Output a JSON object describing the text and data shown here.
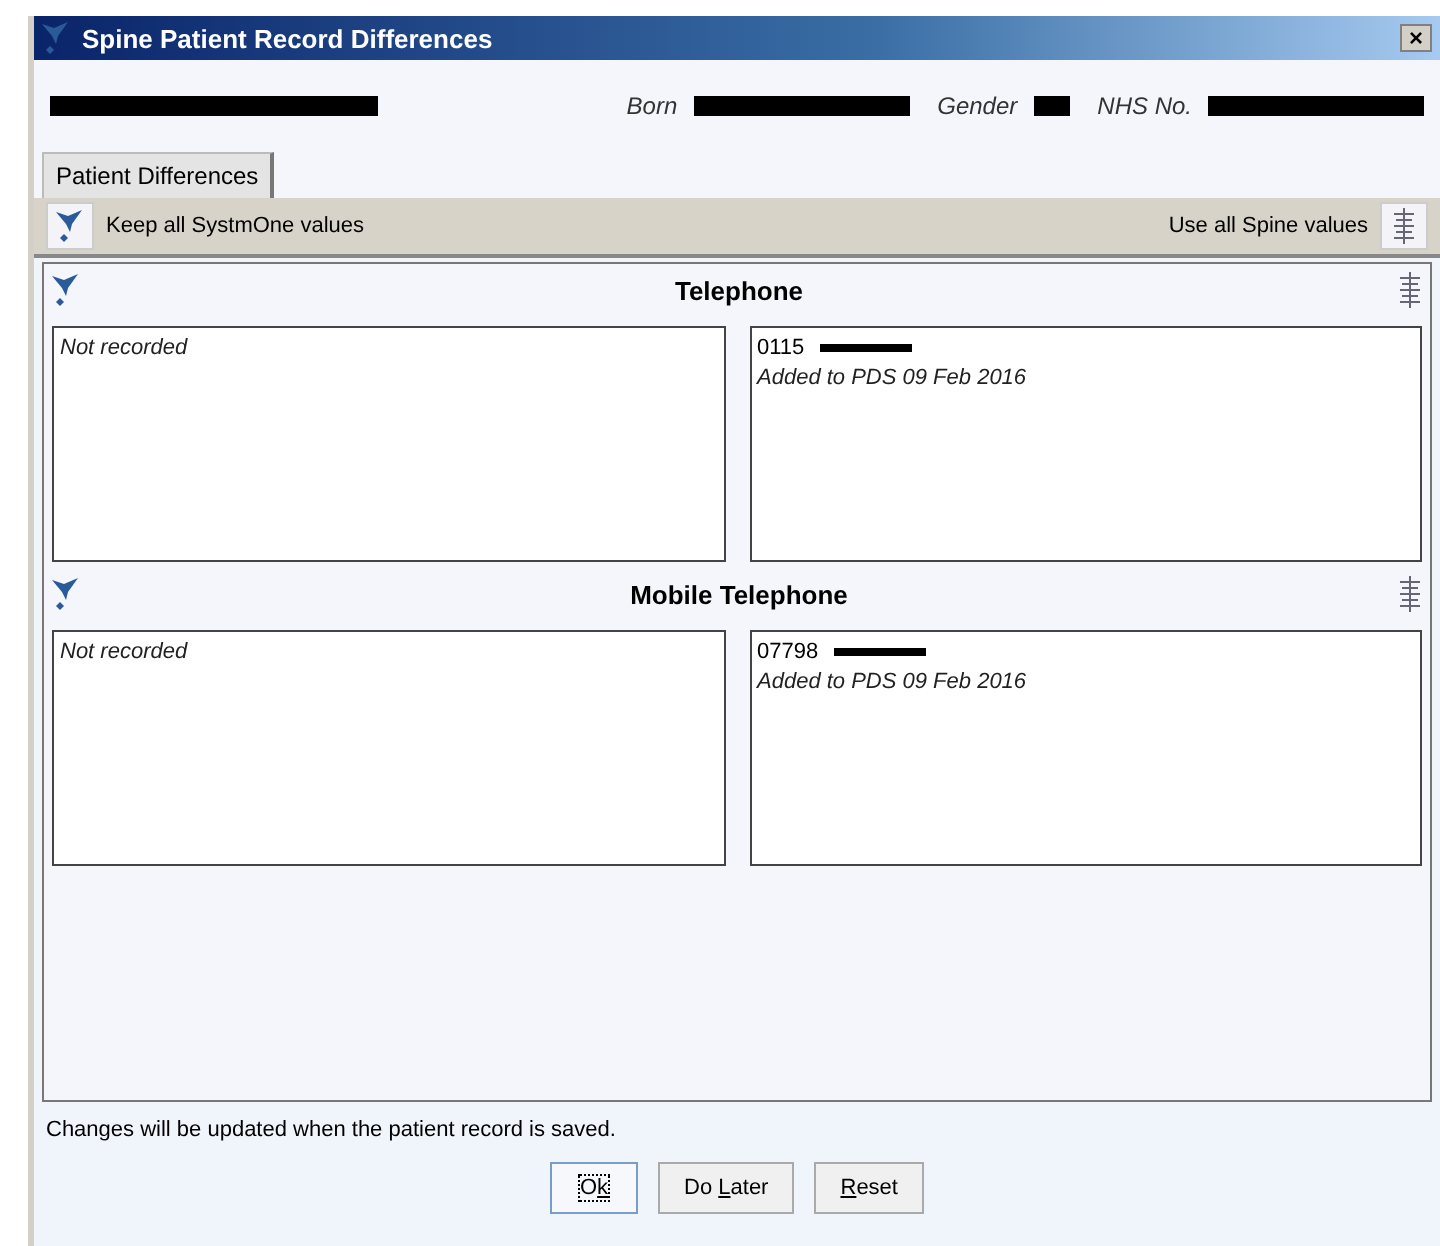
{
  "window": {
    "title": "Spine Patient Record Differences",
    "close": "×"
  },
  "patient": {
    "name_redacted": true,
    "fields": [
      {
        "label": "Born",
        "redacted": true
      },
      {
        "label": "Gender",
        "redacted": true
      },
      {
        "label": "NHS No.",
        "redacted": true
      }
    ]
  },
  "tabs": [
    {
      "label": "Patient Differences",
      "selected": true
    }
  ],
  "toolbar": {
    "keep_all": "Keep all SystmOne values",
    "use_all": "Use all Spine values"
  },
  "sections": [
    {
      "title": "Telephone",
      "local": {
        "text": "Not recorded"
      },
      "spine": {
        "value": "0115",
        "redacted": true,
        "note": "Added to PDS 09 Feb 2016"
      }
    },
    {
      "title": "Mobile Telephone",
      "local": {
        "text": "Not recorded"
      },
      "spine": {
        "value": "07798",
        "redacted": true,
        "note": "Added to PDS 09 Feb 2016"
      }
    }
  ],
  "footer": {
    "message": "Changes will be updated when the patient record is saved."
  },
  "buttons": [
    {
      "label": "Ok",
      "focused": true
    },
    {
      "label": "Do Later",
      "focused": false
    },
    {
      "label": "Reset",
      "focused": false
    }
  ]
}
